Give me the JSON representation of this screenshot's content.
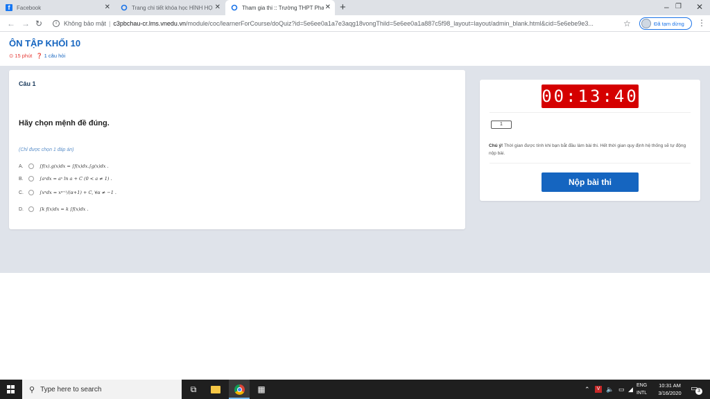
{
  "browser": {
    "tabs": [
      {
        "title": "Facebook",
        "icon": "facebook-icon"
      },
      {
        "title": "Trang chi tiết khóa học HÌNH HỌ",
        "icon": "site-icon"
      },
      {
        "title": "Tham gia thi :: Trường THPT Phan",
        "icon": "site-icon"
      }
    ],
    "new_tab": "+",
    "url": {
      "secure_label": "Không bảo mật",
      "host": "c3pbchau-cr.lms.vnedu.vn",
      "path": "/module/coc/learnerForCourse/doQuiz?id=5e6ee0a1a7e3aqg18vongThild=5e6ee0a1a887c5f98_layout=layout/admin_blank.html&cid=5e6ebe9e3..."
    },
    "profile_label": "Đã tạm dừng"
  },
  "page": {
    "title": "ÔN TẬP KHỐI 10",
    "duration": "15 phút",
    "question_count": "1 câu hỏi"
  },
  "question": {
    "number": "Câu 1",
    "text": "Hãy chọn mệnh đề đúng.",
    "note": "(Chỉ được chọn 1 đáp án)",
    "options": [
      {
        "letter": "A.",
        "formula": "∫f(x).g(x)dx = ∫f(x)dx.∫g(x)dx ."
      },
      {
        "letter": "B.",
        "formula": "∫aˣdx = aˣ ln a + C (0 < a ≠ 1) ."
      },
      {
        "letter": "C.",
        "formula": "∫xᵅdx = xᵅ⁺¹/(α+1) + C, ∀α ≠ −1 ."
      },
      {
        "letter": "D.",
        "formula": "∫k f(x)dx = k ∫f(x)dx ."
      }
    ]
  },
  "sidebar": {
    "timer": "00:13:40",
    "question_nav": "1",
    "notice_label": "Chú ý!",
    "notice_text": "Thời gian được tính khi bạn bắt đầu làm bài thi. Hết thời gian quy định hệ thống sẽ tự động nộp bài.",
    "submit_label": "Nộp bài thi"
  },
  "taskbar": {
    "search_placeholder": "Type here to search",
    "lang_top": "ENG",
    "lang_bottom": "INTL",
    "time": "10:31 AM",
    "date": "3/16/2020",
    "notifications": "3"
  }
}
